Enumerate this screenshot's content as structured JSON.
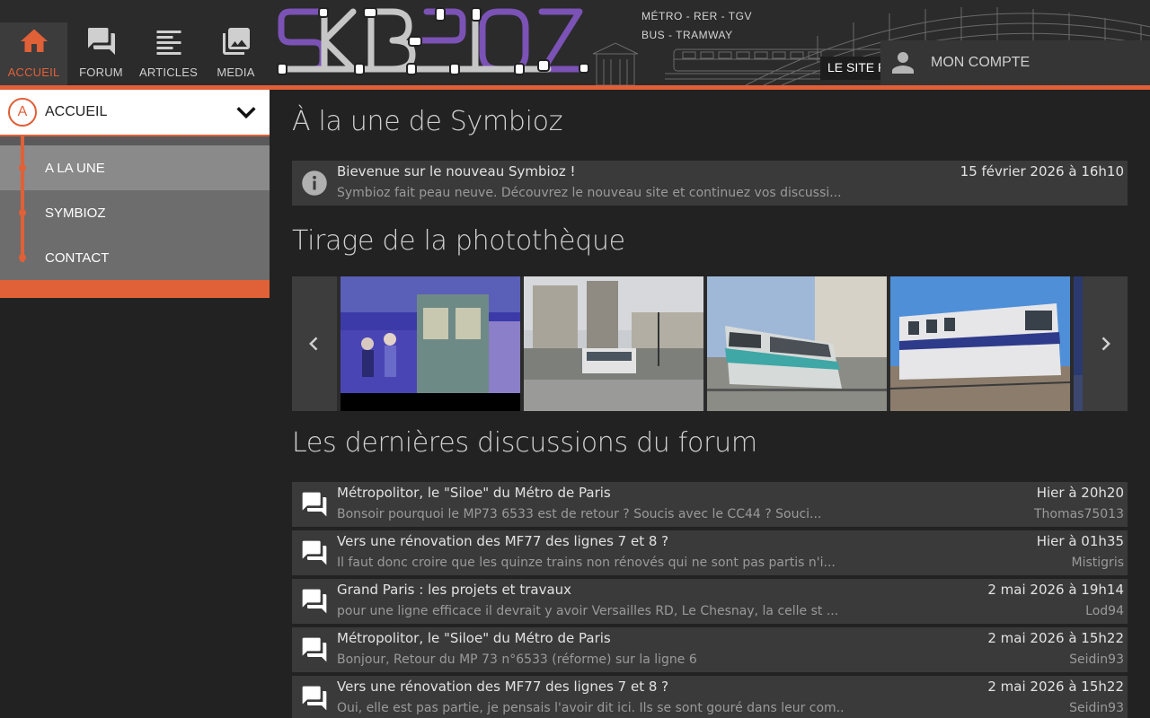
{
  "header": {
    "nav": [
      {
        "label": "ACCUEIL",
        "icon": "home-icon",
        "active": true
      },
      {
        "label": "FORUM",
        "icon": "forum-icon",
        "active": false
      },
      {
        "label": "ARTICLES",
        "icon": "articles-icon",
        "active": false
      },
      {
        "label": "MEDIA",
        "icon": "media-icon",
        "active": false
      }
    ],
    "tagline_line1": "MÉTRO - RER - TGV",
    "tagline_line2": "BUS - TRAMWAY",
    "site_label": "LE SITE P",
    "account_label": "MON COMPTE",
    "accent_color": "#e06037"
  },
  "sidebar": {
    "select_badge": "A",
    "select_label": "ACCUEIL",
    "items": [
      {
        "label": "A LA UNE",
        "active": true
      },
      {
        "label": "SYMBIOZ",
        "active": false
      },
      {
        "label": "CONTACT",
        "active": false
      }
    ]
  },
  "main": {
    "headline_title": "À la une de Symbioz",
    "news": {
      "title": "Bievenue sur le nouveau Symbioz !",
      "excerpt": "Symbioz fait peau neuve. Découvrez le nouveau site et continuez vos discussi...",
      "date": "15 février 2026 à 16h10"
    },
    "gallery_title": "Tirage de la photothèque",
    "gallery_items": [
      "metro-platform-photo",
      "bus-station-photo",
      "tramway-photo",
      "rer-train-photo"
    ],
    "forum_title": "Les dernières discussions du forum",
    "forum": [
      {
        "title": "Métropolitor, le \"Siloe\" du Métro de Paris",
        "excerpt": "Bonsoir pourquoi le MP73 6533 est de retour ? Soucis avec le CC44 ? Souci...",
        "date": "Hier à 20h20",
        "author": "Thomas75013"
      },
      {
        "title": "Vers une rénovation des MF77 des lignes 7 et 8 ?",
        "excerpt": "Il faut donc croire que les quinze trains non rénovés qui ne sont pas partis n'i...",
        "date": "Hier à 01h35",
        "author": "Mistigris"
      },
      {
        "title": "Grand Paris : les projets et travaux",
        "excerpt": "pour une ligne efficace il devrait y avoir Versailles RD, Le Chesnay, la celle st ...",
        "date": "2 mai 2026 à 19h14",
        "author": "Lod94"
      },
      {
        "title": "Métropolitor, le \"Siloe\" du Métro de Paris",
        "excerpt": "Bonjour, Retour du MP 73 n°6533 (réforme) sur la ligne 6",
        "date": "2 mai 2026 à 15h22",
        "author": "Seidin93"
      },
      {
        "title": "Vers une rénovation des MF77 des lignes 7 et 8 ?",
        "excerpt": "Oui, elle est pas partie, je pensais l'avoir dit ici. Ils se sont gouré dans leur com..",
        "date": "2 mai 2026 à 15h22",
        "author": "Seidin93"
      }
    ]
  }
}
